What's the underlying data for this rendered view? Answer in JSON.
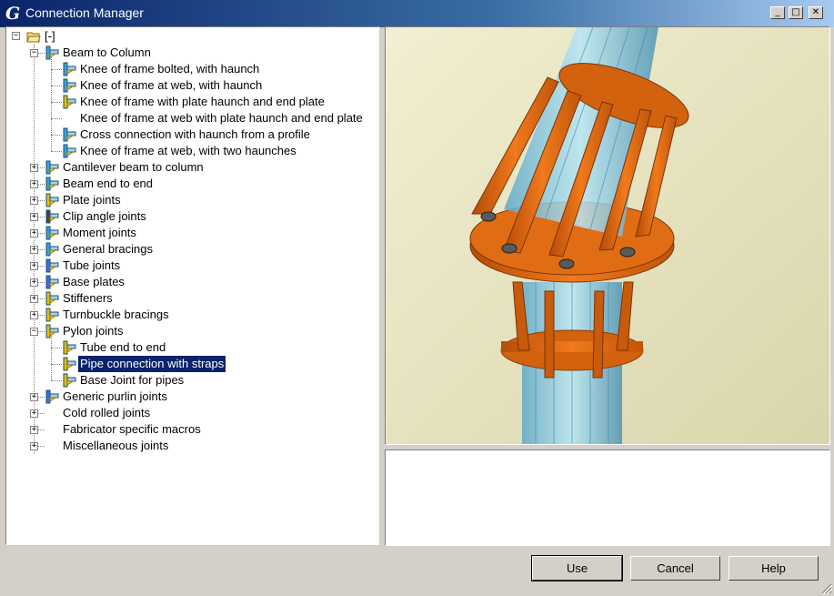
{
  "window": {
    "title": "Connection Manager",
    "minimize_symbol": "_",
    "maximize_symbol": "□",
    "close_symbol": "✕"
  },
  "tree": {
    "root_label": "[-]",
    "nodes": [
      {
        "label": "Beam to Column",
        "icon": "beam-column-icon",
        "expanded": true
      },
      {
        "label": "Knee of frame bolted, with haunch",
        "icon": "knee-frame-icon"
      },
      {
        "label": "Knee of frame  at web, with haunch",
        "icon": "knee-frame-web-icon"
      },
      {
        "label": "Knee of frame with plate haunch and end plate",
        "icon": "knee-plate-icon"
      },
      {
        "label": "Knee of frame at web with plate haunch and end plate",
        "icon": ""
      },
      {
        "label": "Cross connection with haunch from a profile",
        "icon": "cross-connection-icon"
      },
      {
        "label": "Knee of frame  at web, with two haunches",
        "icon": "two-haunches-icon"
      },
      {
        "label": "Cantilever beam to column",
        "icon": "cantilever-icon",
        "expanded": false
      },
      {
        "label": "Beam end to end",
        "icon": "beam-end-icon",
        "expanded": false
      },
      {
        "label": "Plate joints",
        "icon": "plate-joint-icon",
        "expanded": false
      },
      {
        "label": "Clip angle joints",
        "icon": "clip-angle-icon",
        "expanded": false
      },
      {
        "label": "Moment joints",
        "icon": "moment-joint-icon",
        "expanded": false
      },
      {
        "label": "General bracings",
        "icon": "bracing-icon",
        "expanded": false
      },
      {
        "label": "Tube joints",
        "icon": "tube-joint-icon",
        "expanded": false
      },
      {
        "label": "Base plates",
        "icon": "base-plate-icon",
        "expanded": false
      },
      {
        "label": "Stiffeners",
        "icon": "stiffener-icon",
        "expanded": false
      },
      {
        "label": "Turnbuckle bracings",
        "icon": "turnbuckle-icon",
        "expanded": false
      },
      {
        "label": "Pylon joints",
        "icon": "pylon-icon",
        "expanded": true
      },
      {
        "label": "Tube end to end",
        "icon": "tube-end-icon"
      },
      {
        "label": "Pipe connection with straps",
        "icon": "pipe-strap-icon",
        "selected": true
      },
      {
        "label": "Base Joint for pipes",
        "icon": "base-pipe-icon"
      },
      {
        "label": "Generic purlin joints",
        "icon": "purlin-icon",
        "expanded": false
      },
      {
        "label": "Cold rolled joints",
        "icon": "",
        "expanded": false
      },
      {
        "label": "Fabricator specific macros",
        "icon": "",
        "expanded": false
      },
      {
        "label": "Miscellaneous joints",
        "icon": "",
        "expanded": false
      }
    ]
  },
  "preview": {
    "description": "",
    "colors": {
      "background": "#ece9c6",
      "steel": "#e0680f",
      "pipe": "#8ecfe6"
    }
  },
  "buttons": {
    "use": "Use",
    "cancel": "Cancel",
    "help": "Help"
  },
  "colors": {
    "selection": "#0a246a",
    "titlebar": "#0a246a"
  }
}
